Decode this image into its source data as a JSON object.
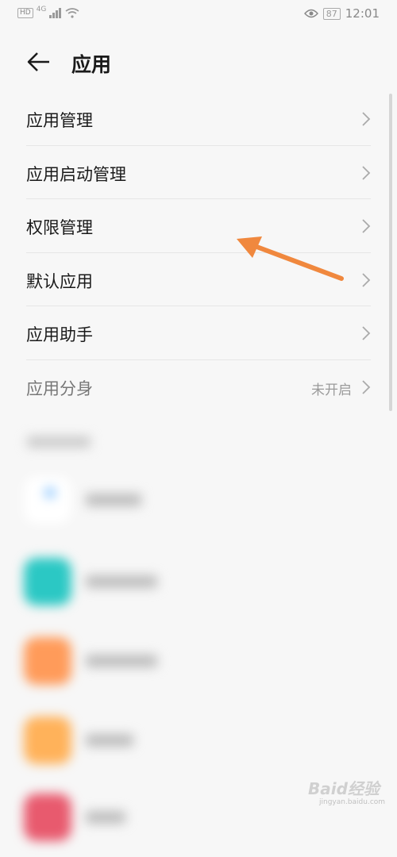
{
  "status_bar": {
    "left_badge": "HD",
    "network": "4G",
    "battery": "87",
    "time": "12:01"
  },
  "header": {
    "title": "应用"
  },
  "menu": [
    {
      "label": "应用管理",
      "value": ""
    },
    {
      "label": "应用启动管理",
      "value": ""
    },
    {
      "label": "权限管理",
      "value": ""
    },
    {
      "label": "默认应用",
      "value": ""
    },
    {
      "label": "应用助手",
      "value": ""
    },
    {
      "label": "应用分身",
      "value": "未开启"
    }
  ],
  "annotation": {
    "color": "#f0883e",
    "points_to": "权限管理"
  },
  "blurred_app_icon_colors": [
    "#8fc8ff",
    "#2bc8c4",
    "#ff9b5a",
    "#ffb25a",
    "#e85a6e"
  ],
  "watermark": {
    "text": "Baid经验",
    "sub": "jingyan.baidu.com"
  },
  "icons": [
    "back-arrow-icon",
    "chevron-right-icon",
    "signal-icon",
    "wifi-icon",
    "eye-icon"
  ]
}
